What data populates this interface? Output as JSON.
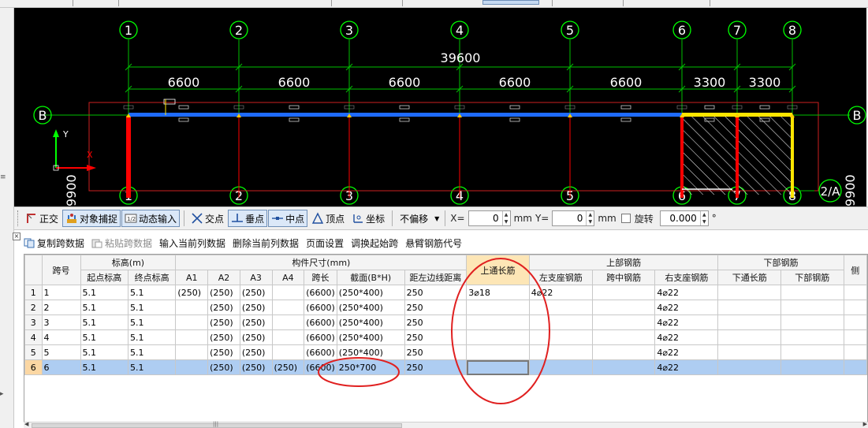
{
  "cad": {
    "axis_labels": [
      "1",
      "2",
      "3",
      "4",
      "5",
      "6",
      "7",
      "8"
    ],
    "bottom_axis_labels": [
      "1",
      "2",
      "3",
      "4",
      "5",
      "6",
      "7",
      "8"
    ],
    "total_dimension": "39600",
    "span_dimensions": [
      "6600",
      "6600",
      "6600",
      "6600",
      "6600",
      "3300",
      "3300"
    ],
    "row_label_left": "B",
    "row_label_right": "B",
    "row_label_bottom_right": "2/A",
    "side_dim_left": "9900",
    "side_dim_right": "9900",
    "ucs_y": "Y",
    "ucs_x": "X"
  },
  "snapbar": {
    "ortho": "正交",
    "object_snap": "对象捕捉",
    "dynamic_input": "动态输入",
    "intersection": "交点",
    "perpendicular": "垂点",
    "midpoint": "中点",
    "vertex": "顶点",
    "coordinate": "坐标",
    "offset_mode": "不偏移",
    "x_label": "X=",
    "x_value": "0",
    "x_unit": "mm",
    "y_label": "Y=",
    "y_value": "0",
    "y_unit": "mm",
    "rotate_label": "旋转",
    "rotate_value": "0.000",
    "degree": "°"
  },
  "grid_toolbar": {
    "copy_span": "复制跨数据",
    "paste_span": "粘贴跨数据",
    "input_col": "输入当前列数据",
    "delete_col": "删除当前列数据",
    "page_setup": "页面设置",
    "swap_start": "调换起始跨",
    "cantilever_code": "悬臂钢筋代号"
  },
  "table": {
    "h_span": "跨号",
    "h_elev": "标高(m)",
    "h_size": "构件尺寸(mm)",
    "h_top_long": "上通长筋",
    "h_top_bar": "上部钢筋",
    "h_bottom_bar": "下部钢筋",
    "h_start_elev": "起点标高",
    "h_end_elev": "终点标高",
    "h_a1": "A1",
    "h_a2": "A2",
    "h_a3": "A3",
    "h_a4": "A4",
    "h_span_len": "跨长",
    "h_section": "截面(B*H)",
    "h_edge_dist": "距左边线距离",
    "h_left_support": "左支座钢筋",
    "h_mid_span": "跨中钢筋",
    "h_right_support": "右支座钢筋",
    "h_bottom_long": "下通长筋",
    "h_bottom_rebar": "下部钢筋",
    "h_more": "侧",
    "rows": [
      {
        "no": "1",
        "span": "1",
        "start": "5.1",
        "end": "5.1",
        "a1": "(250)",
        "a2": "(250)",
        "a3": "(250)",
        "a4": "",
        "len": "(6600)",
        "section": "(250*400)",
        "dist": "250",
        "top_long": "3⌀18",
        "left": "4⌀22",
        "mid": "",
        "right": "4⌀22",
        "b_long": "",
        "b_bar": ""
      },
      {
        "no": "2",
        "span": "2",
        "start": "5.1",
        "end": "5.1",
        "a1": "",
        "a2": "(250)",
        "a3": "(250)",
        "a4": "",
        "len": "(6600)",
        "section": "(250*400)",
        "dist": "250",
        "top_long": "",
        "left": "",
        "mid": "",
        "right": "4⌀22",
        "b_long": "",
        "b_bar": ""
      },
      {
        "no": "3",
        "span": "3",
        "start": "5.1",
        "end": "5.1",
        "a1": "",
        "a2": "(250)",
        "a3": "(250)",
        "a4": "",
        "len": "(6600)",
        "section": "(250*400)",
        "dist": "250",
        "top_long": "",
        "left": "",
        "mid": "",
        "right": "4⌀22",
        "b_long": "",
        "b_bar": ""
      },
      {
        "no": "4",
        "span": "4",
        "start": "5.1",
        "end": "5.1",
        "a1": "",
        "a2": "(250)",
        "a3": "(250)",
        "a4": "",
        "len": "(6600)",
        "section": "(250*400)",
        "dist": "250",
        "top_long": "",
        "left": "",
        "mid": "",
        "right": "4⌀22",
        "b_long": "",
        "b_bar": ""
      },
      {
        "no": "5",
        "span": "5",
        "start": "5.1",
        "end": "5.1",
        "a1": "",
        "a2": "(250)",
        "a3": "(250)",
        "a4": "",
        "len": "(6600)",
        "section": "(250*400)",
        "dist": "250",
        "top_long": "",
        "left": "",
        "mid": "",
        "right": "4⌀22",
        "b_long": "",
        "b_bar": ""
      },
      {
        "no": "6",
        "span": "6",
        "start": "5.1",
        "end": "5.1",
        "a1": "",
        "a2": "(250)",
        "a3": "(250)",
        "a4": "(250)",
        "len": "(6600)",
        "section": "250*700",
        "dist": "250",
        "top_long": "",
        "left": "",
        "mid": "",
        "right": "4⌀22",
        "b_long": "",
        "b_bar": ""
      }
    ]
  },
  "colors": {
    "cad_background": "#000000",
    "axis_circle": "#00ff00",
    "beam_blue": "#1f6bff",
    "column_red": "#ff0000",
    "beam_yellow": "#ffe600",
    "selected_row": "#aecdf2",
    "highlight_header": "#fde6b6",
    "annotation_red": "#e02020"
  }
}
